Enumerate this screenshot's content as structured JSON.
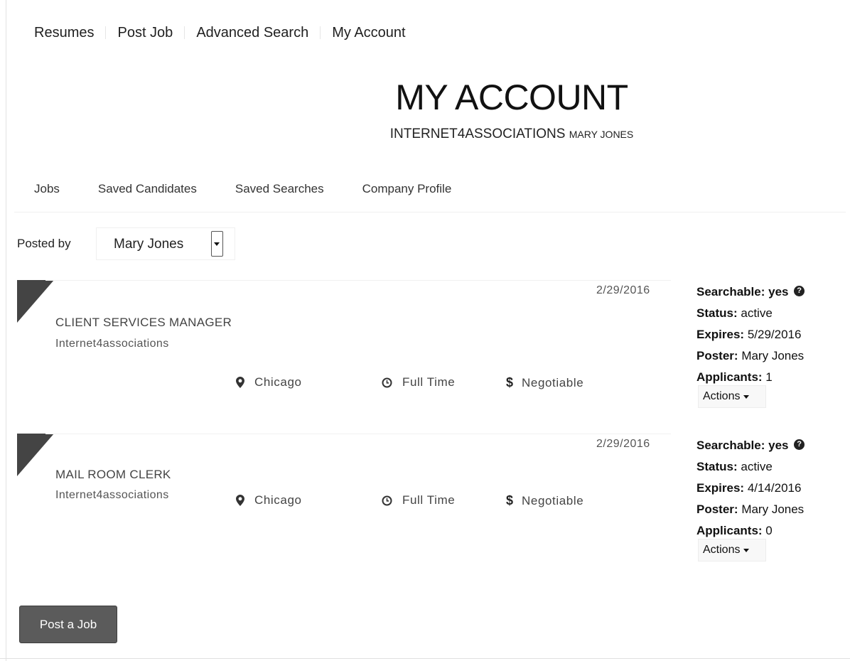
{
  "nav": {
    "items": [
      "Resumes",
      "Post Job",
      "Advanced Search",
      "My Account"
    ]
  },
  "header": {
    "title": "MY ACCOUNT",
    "company": "INTERNET4ASSOCIATIONS",
    "user": "MARY JONES"
  },
  "tabs": [
    "Jobs",
    "Saved Candidates",
    "Saved Searches",
    "Company Profile"
  ],
  "filter": {
    "label": "Posted by",
    "value": "Mary Jones"
  },
  "jobs": [
    {
      "date": "2/29/2016",
      "title": "CLIENT SERVICES MANAGER",
      "company": "Internet4associations",
      "location": "Chicago",
      "type": "Full Time",
      "salary": "Negotiable",
      "searchable_label": "Searchable:",
      "searchable": "yes",
      "status_label": "Status:",
      "status": "active",
      "expires_label": "Expires:",
      "expires": "5/29/2016",
      "poster_label": "Poster:",
      "poster": "Mary Jones",
      "applicants_label": "Applicants:",
      "applicants": "1",
      "actions_label": "Actions"
    },
    {
      "date": "2/29/2016",
      "title": "MAIL ROOM CLERK",
      "company": "Internet4associations",
      "location": "Chicago",
      "type": "Full Time",
      "salary": "Negotiable",
      "searchable_label": "Searchable:",
      "searchable": "yes",
      "status_label": "Status:",
      "status": "active",
      "expires_label": "Expires:",
      "expires": "4/14/2016",
      "poster_label": "Poster:",
      "poster": "Mary Jones",
      "applicants_label": "Applicants:",
      "applicants": "0",
      "actions_label": "Actions"
    }
  ],
  "post_job_button": "Post a Job",
  "icons": {
    "location": "map-marker-icon",
    "type": "clock-icon",
    "salary": "dollar-icon",
    "help": "question-circle-icon"
  }
}
